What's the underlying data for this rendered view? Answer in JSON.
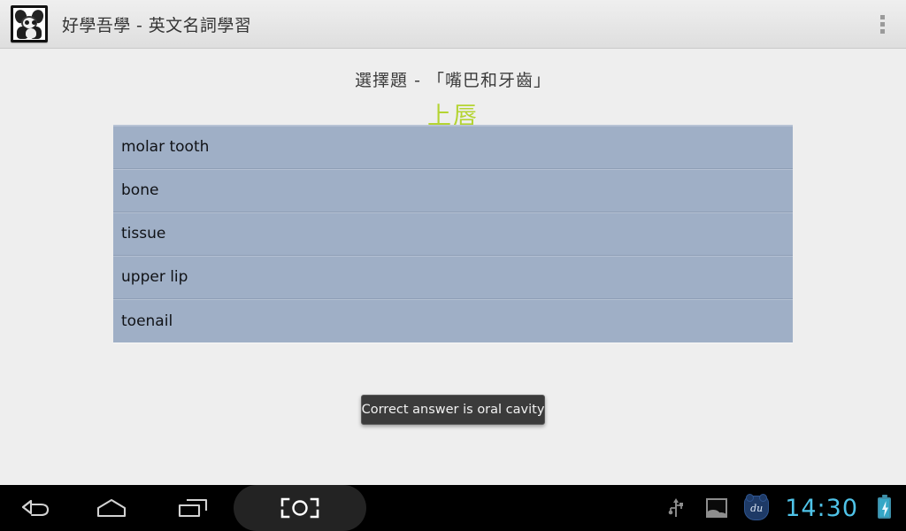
{
  "action_bar": {
    "app_icon_name": "panda-app-icon",
    "title": "好學吾學 - 英文名詞學習",
    "overflow_label": "overflow-menu"
  },
  "quiz": {
    "heading": "選擇題 - 「嘴巴和牙齒」",
    "term": "上唇",
    "term_color": "#b4d432",
    "options": [
      {
        "label": "molar tooth"
      },
      {
        "label": "bone"
      },
      {
        "label": "tissue"
      },
      {
        "label": "upper lip"
      },
      {
        "label": "toenail"
      }
    ]
  },
  "toast": {
    "message": "Correct answer is oral cavity"
  },
  "nav_bar": {
    "buttons": [
      {
        "name": "back-icon"
      },
      {
        "name": "home-icon"
      },
      {
        "name": "recents-icon"
      },
      {
        "name": "screenshot-icon"
      }
    ],
    "status": {
      "usb_icon": "usb-icon",
      "gallery_icon": "gallery-icon",
      "du_badge_text": "du",
      "clock": "14:30",
      "battery_icon": "battery-charging-icon"
    }
  },
  "colors": {
    "background": "#eeeeee",
    "list_background": "#9fafc6",
    "accent_green": "#b4d432",
    "clock_cyan": "#4fc3e8",
    "toast_background": "#3b3b3b"
  }
}
